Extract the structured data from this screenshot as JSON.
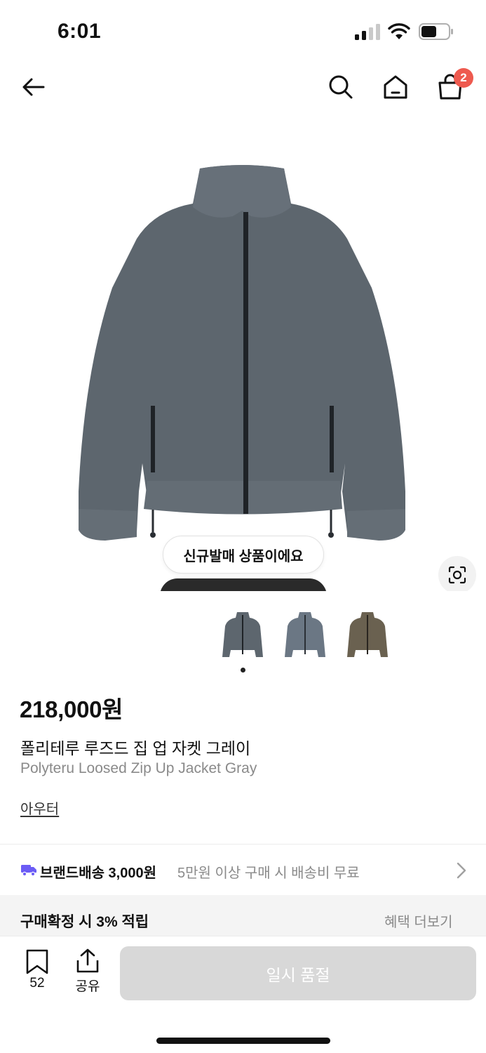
{
  "status_bar": {
    "time": "6:01"
  },
  "nav": {
    "cart_count": "2"
  },
  "hero": {
    "new_badge": "신규발매 상품이에요"
  },
  "colors": {
    "accent_badge": "#ee5a4f",
    "shipping_icon": "#6b5cf5",
    "jacket_gray": "#5d666e",
    "jacket_blue_gray": "#6b7784",
    "jacket_brown": "#6a6150"
  },
  "product": {
    "price": "218,000원",
    "name_ko": "폴리테루 루즈드 집 업 자켓 그레이",
    "name_en": "Polyteru Loosed Zip Up Jacket Gray",
    "category": "아우터"
  },
  "shipping": {
    "label": "브랜드배송 3,000원",
    "note": "5만원 이상 구매 시 배송비 무료"
  },
  "benefit": {
    "label": "구매확정 시 3% 적립",
    "more": "혜택 더보기"
  },
  "bottom": {
    "bookmark_count": "52",
    "share_label": "공유",
    "buy_label": "일시 품절"
  }
}
